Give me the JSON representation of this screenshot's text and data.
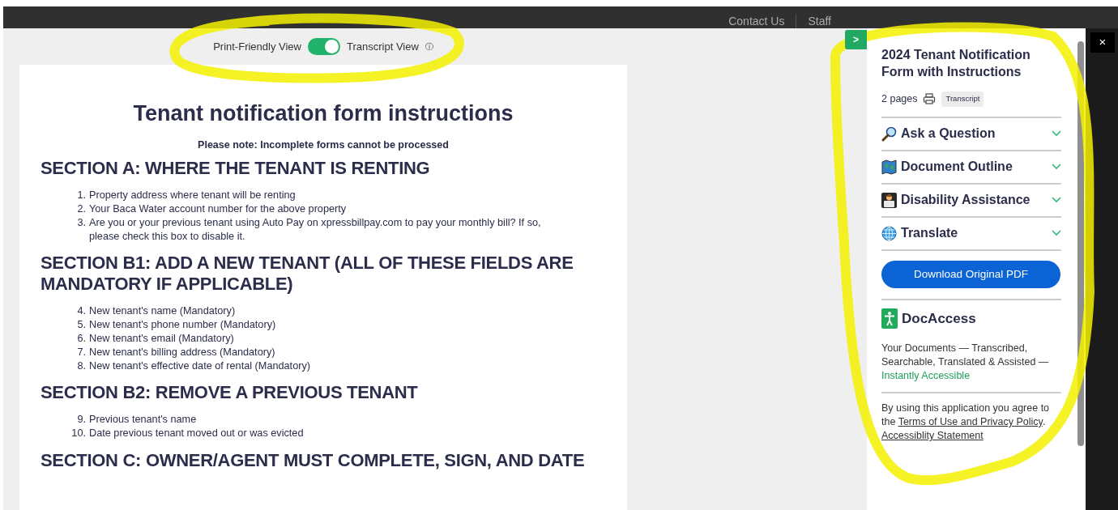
{
  "site_header": {
    "links": [
      "Contact Us",
      "Staff"
    ]
  },
  "view_toggle": {
    "left_label": "Print-Friendly View",
    "on": true,
    "right_label": "Transcript View",
    "info": "ⓘ"
  },
  "document": {
    "title": "Tenant notification form instructions",
    "note": "Please note: Incomplete forms cannot be processed",
    "sections": [
      {
        "heading": "SECTION A: WHERE THE TENANT IS RENTING",
        "items": [
          {
            "number": "1.",
            "text": "Property address where tenant will be renting"
          },
          {
            "number": "2.",
            "text": "Your Baca Water account number for the above property"
          },
          {
            "number": "3.",
            "text": "Are you or your previous tenant using Auto Pay on xpressbillpay.com to pay your monthly bill? If so, please check this box to disable it."
          }
        ]
      },
      {
        "heading": "SECTION B1: ADD A NEW TENANT (ALL OF THESE FIELDS ARE MANDATORY IF APPLICABLE)",
        "items": [
          {
            "number": "4.",
            "text": "New tenant's name (Mandatory)"
          },
          {
            "number": "5.",
            "text": "New tenant's phone number (Mandatory)"
          },
          {
            "number": "6.",
            "text": "New tenant's email (Mandatory)"
          },
          {
            "number": "7.",
            "text": "New tenant's billing address (Mandatory)"
          },
          {
            "number": "8.",
            "text": "New tenant's effective date of rental (Mandatory)"
          }
        ]
      },
      {
        "heading": "SECTION B2: REMOVE A PREVIOUS TENANT",
        "items": [
          {
            "number": "9.",
            "text": "Previous tenant's name"
          },
          {
            "number": "10.",
            "text": "Date previous tenant moved out or was evicted"
          }
        ]
      },
      {
        "heading": "SECTION C: OWNER/AGENT MUST COMPLETE, SIGN, AND DATE"
      }
    ]
  },
  "side_panel": {
    "collapse_button": ">",
    "title": "2024 Tenant Notification Form with Instructions",
    "pages": "2 pages",
    "tag": "Transcript",
    "accordions": [
      {
        "kind": "search",
        "label": "Ask a Question",
        "expanded": false
      },
      {
        "kind": "map",
        "label": "Document Outline",
        "expanded": false
      },
      {
        "kind": "person",
        "label": "Disability Assistance",
        "expanded": false
      },
      {
        "kind": "globe",
        "label": "Translate",
        "expanded": false
      }
    ],
    "download_button": "Download Original PDF",
    "brand": "DocAccess",
    "tagline": "Your Documents — Transcribed, Searchable, Translated & Assisted —",
    "tagline_highlight": "Instantly Accessible",
    "legal_text": "By using this application you agree to the",
    "legal_links": [
      "Terms of Use and Privacy Policy",
      "Accessiblity Statement"
    ],
    "legal_separator": "."
  },
  "close_button": "×",
  "highlights": {
    "toggle_ring": true,
    "panel_loop": true
  }
}
